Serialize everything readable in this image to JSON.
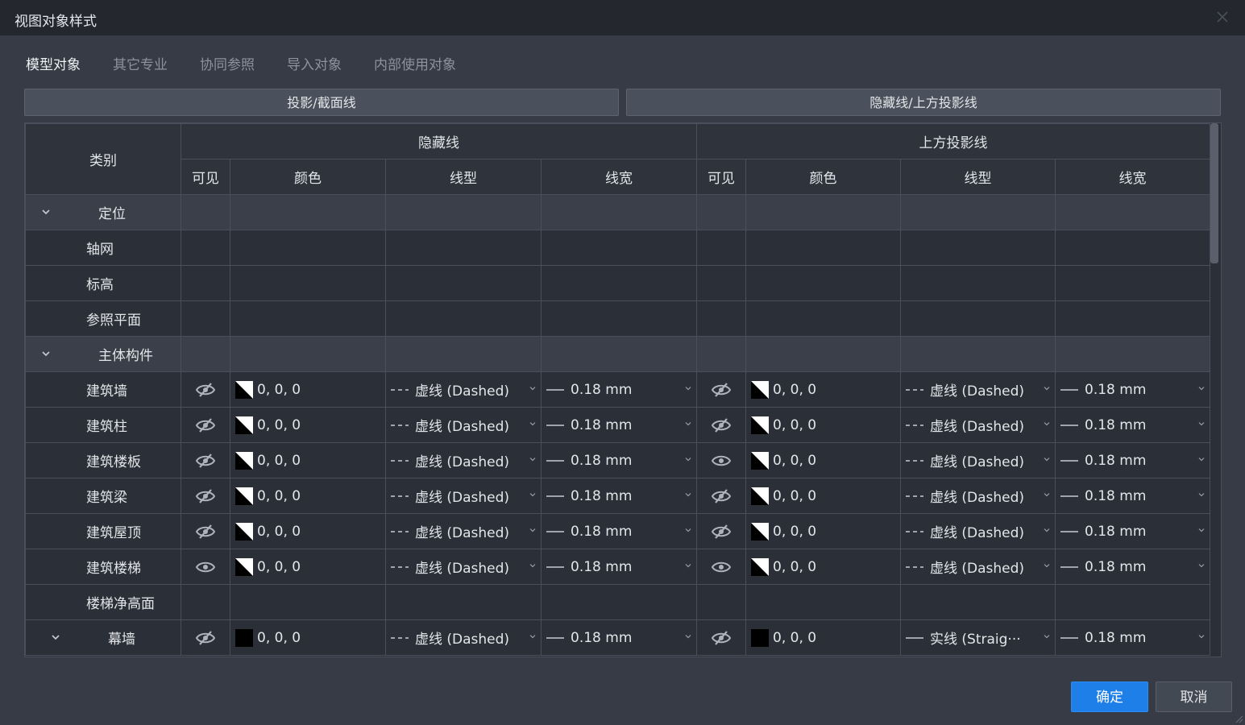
{
  "window": {
    "title": "视图对象样式"
  },
  "tabs": [
    {
      "label": "模型对象",
      "active": true
    },
    {
      "label": "其它专业",
      "active": false
    },
    {
      "label": "协同参照",
      "active": false
    },
    {
      "label": "导入对象",
      "active": false
    },
    {
      "label": "内部使用对象",
      "active": false
    }
  ],
  "segments": {
    "projection": "投影/截面线",
    "hidden": "隐藏线/上方投影线"
  },
  "table": {
    "category_header": "类别",
    "group_hidden": "隐藏线",
    "group_above": "上方投影线",
    "col_visible": "可见",
    "col_color": "颜色",
    "col_linetype": "线型",
    "col_linewidth": "线宽",
    "rows": [
      {
        "kind": "group",
        "name": "定位"
      },
      {
        "kind": "empty",
        "name": "轴网"
      },
      {
        "kind": "empty",
        "name": "标高"
      },
      {
        "kind": "empty",
        "name": "参照平面"
      },
      {
        "kind": "group",
        "name": "主体构件"
      },
      {
        "kind": "data",
        "name": "建筑墙",
        "h_visible": false,
        "h_color": "0, 0, 0",
        "h_linetype": "虚线 (Dashed)",
        "h_width": "0.18 mm",
        "a_visible": false,
        "a_color": "0, 0, 0",
        "a_linetype": "虚线 (Dashed)",
        "a_width": "0.18 mm"
      },
      {
        "kind": "data",
        "name": "建筑柱",
        "h_visible": false,
        "h_color": "0, 0, 0",
        "h_linetype": "虚线 (Dashed)",
        "h_width": "0.18 mm",
        "a_visible": false,
        "a_color": "0, 0, 0",
        "a_linetype": "虚线 (Dashed)",
        "a_width": "0.18 mm"
      },
      {
        "kind": "data",
        "name": "建筑楼板",
        "h_visible": false,
        "h_color": "0, 0, 0",
        "h_linetype": "虚线 (Dashed)",
        "h_width": "0.18 mm",
        "a_visible": true,
        "a_color": "0, 0, 0",
        "a_linetype": "虚线 (Dashed)",
        "a_width": "0.18 mm"
      },
      {
        "kind": "data",
        "name": "建筑梁",
        "h_visible": false,
        "h_color": "0, 0, 0",
        "h_linetype": "虚线 (Dashed)",
        "h_width": "0.18 mm",
        "a_visible": false,
        "a_color": "0, 0, 0",
        "a_linetype": "虚线 (Dashed)",
        "a_width": "0.18 mm"
      },
      {
        "kind": "data",
        "name": "建筑屋顶",
        "h_visible": false,
        "h_color": "0, 0, 0",
        "h_linetype": "虚线 (Dashed)",
        "h_width": "0.18 mm",
        "a_visible": false,
        "a_color": "0, 0, 0",
        "a_linetype": "虚线 (Dashed)",
        "a_width": "0.18 mm"
      },
      {
        "kind": "data",
        "name": "建筑楼梯",
        "h_visible": true,
        "h_color": "0, 0, 0",
        "h_linetype": "虚线 (Dashed)",
        "h_width": "0.18 mm",
        "a_visible": true,
        "a_color": "0, 0, 0",
        "a_linetype": "虚线 (Dashed)",
        "a_width": "0.18 mm"
      },
      {
        "kind": "empty",
        "name": "楼梯净高面"
      },
      {
        "kind": "data",
        "name": "幕墙",
        "expandable": true,
        "solid_swatch": true,
        "h_visible": false,
        "h_color": "0, 0, 0",
        "h_linetype": "虚线 (Dashed)",
        "h_width": "0.18 mm",
        "a_visible": false,
        "a_color": "0, 0, 0",
        "a_linetype": "实线 (Straig···",
        "a_linestyle": "solid",
        "a_width": "0.18 mm"
      }
    ]
  },
  "buttons": {
    "ok": "确定",
    "cancel": "取消"
  },
  "colors": {
    "accent": "#1f7fe8",
    "background": "#363b45",
    "titlebar": "#24272e",
    "grid_line": "#4a505b"
  },
  "icons": {
    "visible": "eye-icon",
    "hidden": "eye-slash-icon",
    "expand": "chevron-down-icon",
    "close": "close-icon"
  }
}
